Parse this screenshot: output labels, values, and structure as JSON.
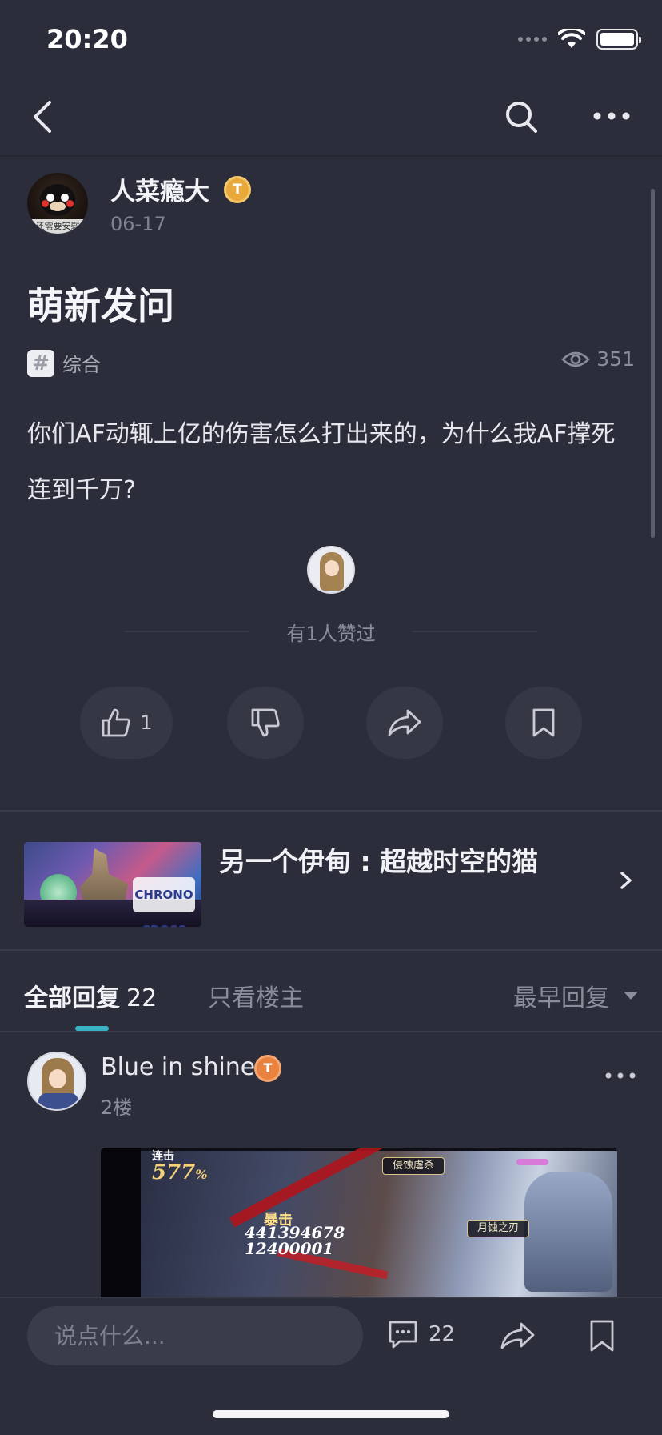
{
  "status_bar": {
    "time": "20:20"
  },
  "post": {
    "author": {
      "name": "人菜瘾大",
      "level_badge": "T",
      "date": "06-17",
      "avatar_caption": "还需要安慰"
    },
    "title": "萌新发问",
    "topic": "综合",
    "views": "351",
    "body": "你们AF动辄上亿的伤害怎么打出来的，为什么我AF撑死连到千万?",
    "likers_text": "有1人赞过",
    "actions": {
      "like_count": "1"
    }
  },
  "game_card": {
    "title": "另一个伊甸 : 超越时空的猫",
    "banner_logo": "CHRONO CROSS"
  },
  "reply_tabs": {
    "all_label": "全部回复",
    "all_count": "22",
    "op_only_label": "只看楼主",
    "sort_label": "最早回复"
  },
  "reply": {
    "name": "Blue in shine",
    "level_badge": "T",
    "floor": "2楼",
    "image": {
      "combo": "577",
      "combo_unit": "%",
      "combo_label": "连击",
      "crit_label": "暴击",
      "damage_line1": "441394678",
      "damage_line2": "12400001",
      "skill1": "侵蚀虐杀",
      "skill2": "月蚀之刃"
    }
  },
  "bottom_bar": {
    "input_placeholder": "说点什么...",
    "comments_count": "22"
  },
  "colors": {
    "background": "#2b2d3a",
    "accent": "#38b3c3",
    "badge_gold": "#e9a93a",
    "badge_orange": "#e8823e"
  }
}
